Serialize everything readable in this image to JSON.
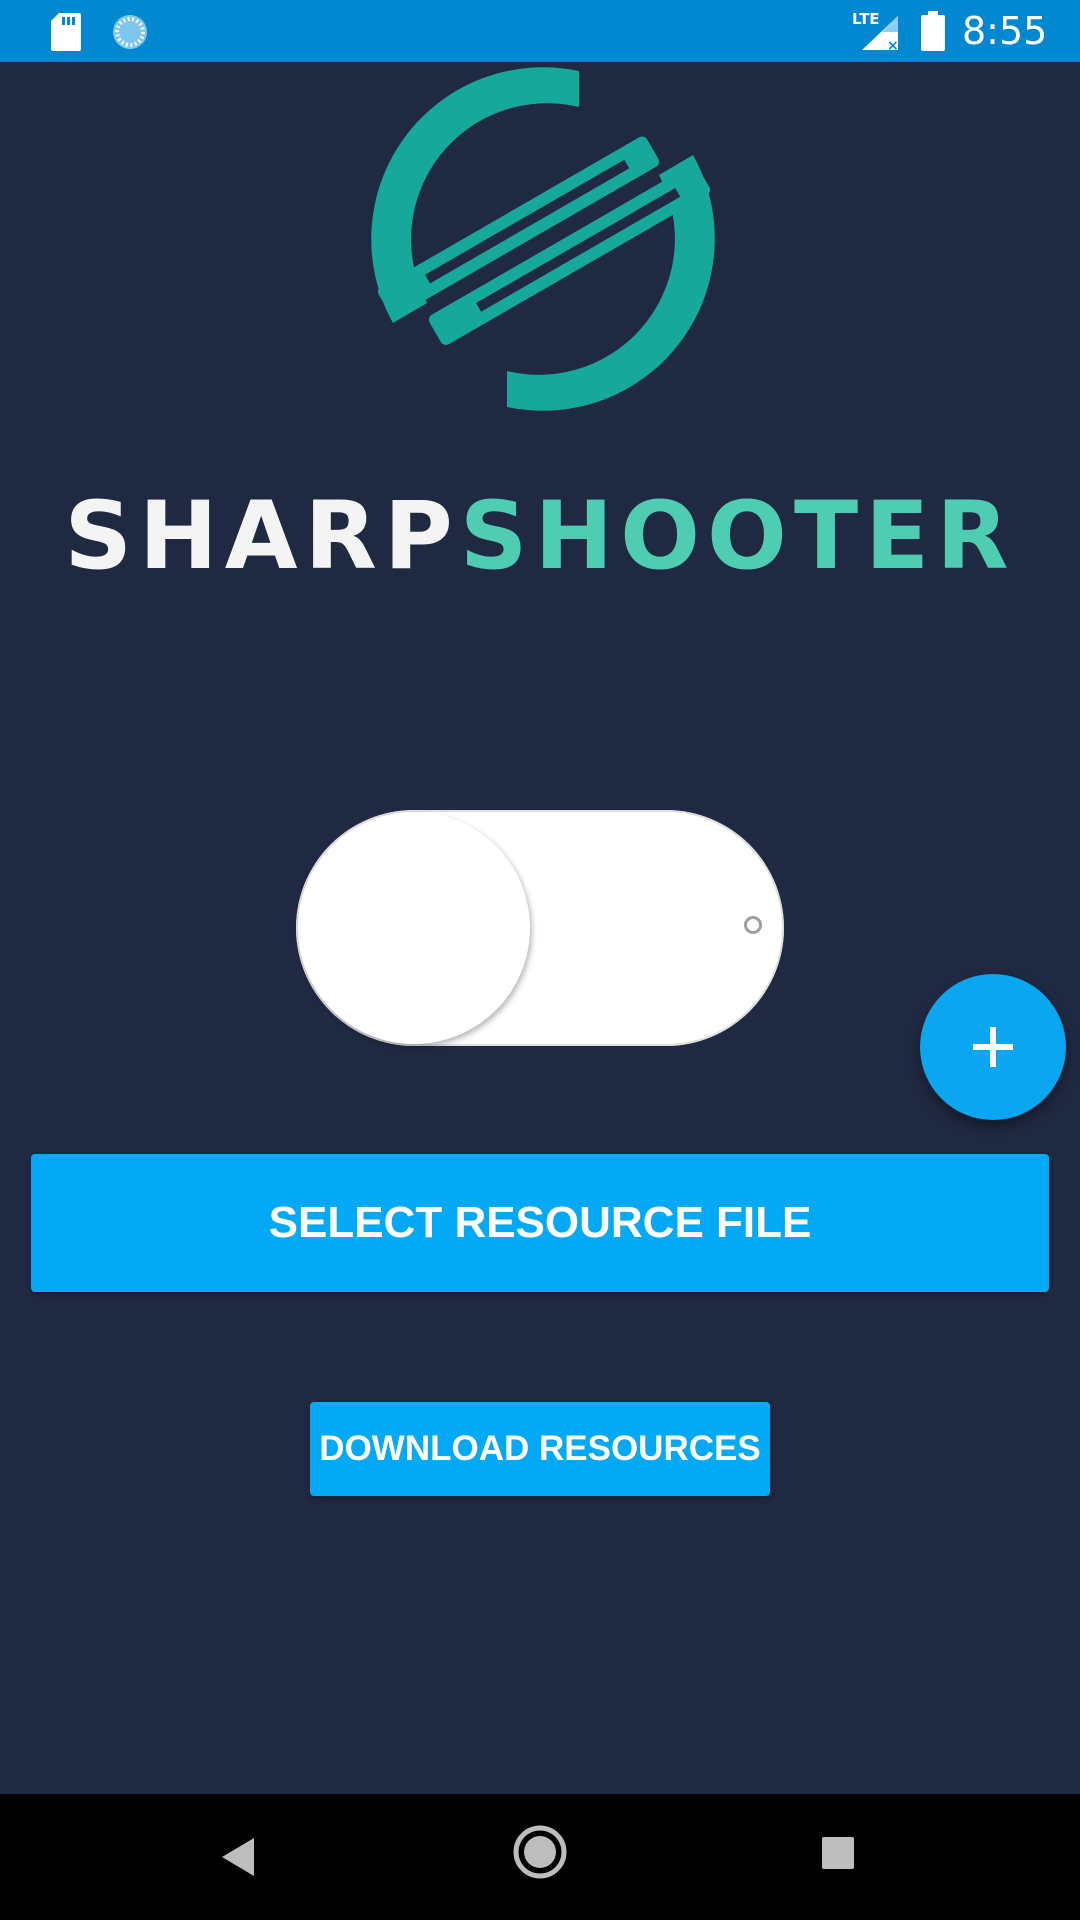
{
  "status_bar": {
    "time": "8:55",
    "icons": [
      "sd-card-icon",
      "sync-icon",
      "lte-signal-icon",
      "battery-icon"
    ]
  },
  "brand": {
    "name_part1": "SHARP",
    "name_part2": "SHOOTER",
    "colors": {
      "white": "#f4f4f4",
      "teal": "#4fcdb3",
      "logo": "#17a89c"
    }
  },
  "toggle": {
    "state": "off"
  },
  "buttons": {
    "select_resource": "SELECT RESOURCE FILE",
    "download_resources": "DOWNLOAD RESOURCES",
    "fab_icon": "plus-icon"
  },
  "nav_bar": {
    "icons": [
      "back-icon",
      "home-icon",
      "recents-icon"
    ]
  },
  "colors": {
    "background": "#1f2941",
    "status_bar": "#0288d1",
    "accent": "#03a9f4"
  }
}
